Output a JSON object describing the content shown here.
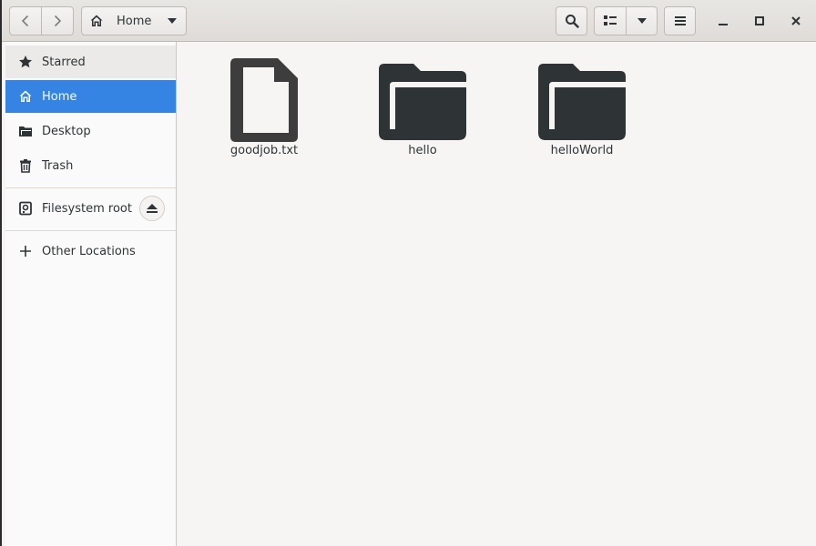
{
  "header": {
    "path_label": "Home",
    "icons": {
      "back": "chevron-left-icon",
      "forward": "chevron-right-icon",
      "home": "home-icon",
      "search": "search-icon",
      "view": "list-view-icon",
      "menu": "hamburger-menu-icon"
    }
  },
  "sidebar": {
    "items": [
      {
        "label": "Starred",
        "icon": "star-icon"
      },
      {
        "label": "Home",
        "icon": "home-icon",
        "active": true
      },
      {
        "label": "Desktop",
        "icon": "folder-icon"
      },
      {
        "label": "Trash",
        "icon": "trash-icon"
      },
      {
        "label": "Filesystem root",
        "icon": "drive-icon"
      },
      {
        "label": "Other Locations",
        "icon": "plus-icon"
      }
    ]
  },
  "files": [
    {
      "name": "goodjob.txt",
      "type": "file"
    },
    {
      "name": "hello",
      "type": "folder"
    },
    {
      "name": "helloWorld",
      "type": "folder"
    }
  ],
  "colors": {
    "accent": "#3584e4",
    "icon_dark": "#2e3436",
    "file_icon": "#3d3d3d"
  }
}
